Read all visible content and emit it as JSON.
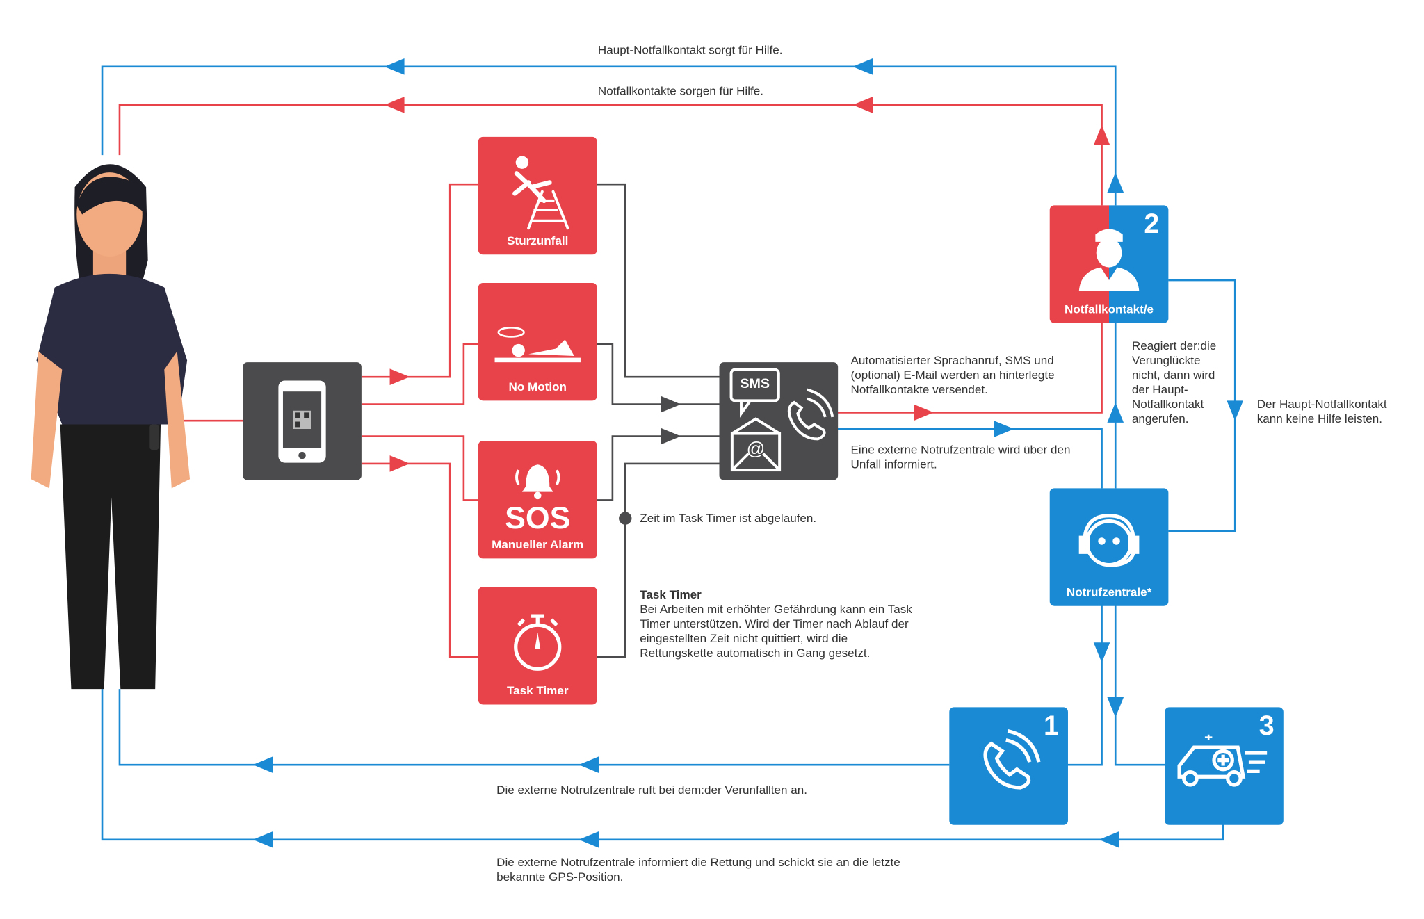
{
  "colors": {
    "red": "#e8434a",
    "blue": "#1a8ad4",
    "dark": "#4b4b4d"
  },
  "top": {
    "blue_label": "Haupt-Notfallkontakt sorgt für Hilfe.",
    "red_label": "Notfallkontakte sorgen für Hilfe."
  },
  "triggers": [
    {
      "label": "Sturzunfall",
      "icon": "falling-ladder-icon"
    },
    {
      "label": "No Motion",
      "icon": "lying-person-icon"
    },
    {
      "label": "SOS",
      "sublabel": "Manueller Alarm",
      "icon": "alarm-bell-icon"
    },
    {
      "label": "Task Timer",
      "icon": "stopwatch-icon"
    }
  ],
  "device": {
    "icon": "smartphone-qr-icon"
  },
  "alert_hub": {
    "badge": "SMS",
    "icons": [
      "sms-icon",
      "email-icon",
      "phone-icon"
    ]
  },
  "notes": {
    "auto_call": "Automatisierter Sprachanruf, SMS und (optional) E-Mail werden an hinterlegte Notfallkontakte versendet.",
    "external": "Eine externe Notrufzentrale wird über den Unfall informiert.",
    "timer_expired": "Zeit im Task Timer ist abgelaufen.",
    "task_timer_title": "Task Timer",
    "task_timer_text": "Bei Arbeiten mit erhöhter Gefährdung kann ein Task Timer unterstützen. Wird der Timer nach Ablauf der eingestellten Zeit nicht quittiert, wird die Rettungskette automatisch in Gang gesetzt.",
    "no_response": "Reagiert der:die Verunglückte nicht, dann wird der Haupt-Notfallkontakt angerufen.",
    "no_help": "Der Haupt-Notfallkontakt kann keine Hilfe leisten.",
    "calls_victim": "Die externe Notrufzentrale ruft bei dem:der Verunfallten an.",
    "informs_rescue": "Die externe Notrufzentrale informiert die Rettung  und schickt sie an die letzte bekannte GPS-Position."
  },
  "responders": {
    "contact": {
      "label": "Notfallkontakt/e",
      "number": "2"
    },
    "center": {
      "label": "Notrufzentrale*"
    },
    "call": {
      "number": "1"
    },
    "ambulance": {
      "number": "3"
    }
  }
}
